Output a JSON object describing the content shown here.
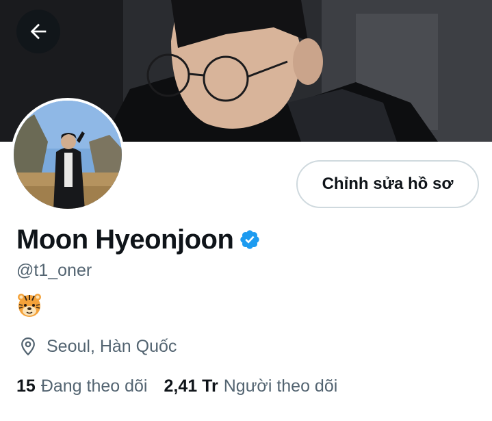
{
  "header": {
    "back_icon": "arrow-left-icon",
    "banner_image": "banner-photo"
  },
  "profile": {
    "avatar_image": "profile-avatar-photo",
    "edit_button_label": "Chỉnh sửa hồ sơ",
    "display_name": "Moon Hyeonjoon",
    "verified_icon": "verified-badge-icon",
    "handle": "@t1_oner",
    "bio_emoji": "🐯",
    "location_icon": "location-pin-icon",
    "location": "Seoul, Hàn Quốc"
  },
  "stats": {
    "following_count": "15",
    "following_label": "Đang theo dõi",
    "followers_count": "2,41 Tr",
    "followers_label": "Người theo dõi"
  },
  "colors": {
    "verified_blue": "#1d9bf0",
    "text_primary": "#0f1419",
    "text_secondary": "#536471",
    "border": "#cfd9de"
  }
}
